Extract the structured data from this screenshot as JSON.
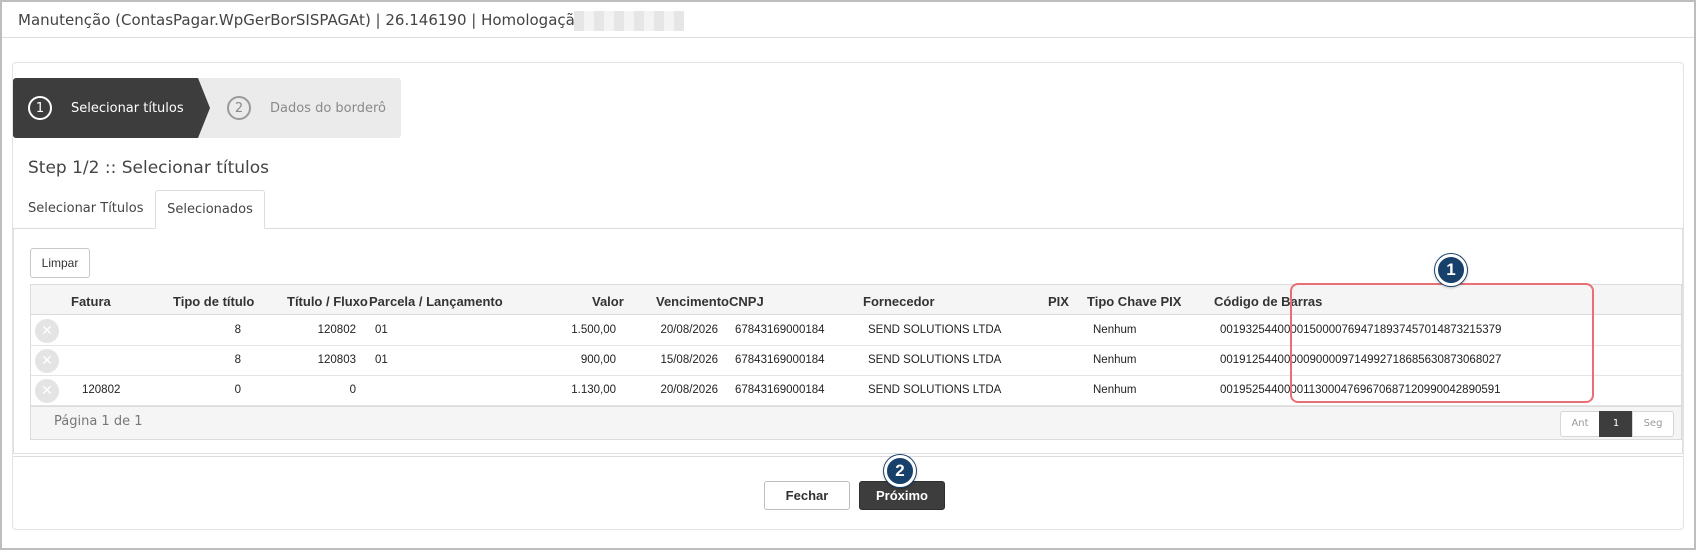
{
  "window": {
    "title": "Manutenção (ContasPagar.WpGerBorSISPAGAt) | 26.146190 | Homologação |"
  },
  "wizard": {
    "steps": [
      {
        "number": "1",
        "label": "Selecionar títulos",
        "active": true
      },
      {
        "number": "2",
        "label": "Dados do borderô",
        "active": false
      }
    ],
    "heading": "Step 1/2 :: Selecionar títulos"
  },
  "tabs": [
    {
      "label": "Selecionar Títulos",
      "selected": false
    },
    {
      "label": "Selecionados",
      "selected": true
    }
  ],
  "toolbar": {
    "limpar_label": "Limpar"
  },
  "grid": {
    "columns": [
      "Fatura",
      "Tipo de título",
      "Título / Fluxo",
      "Parcela / Lançamento",
      "Valor",
      "Vencimento",
      "CNPJ",
      "Fornecedor",
      "PIX",
      "Tipo Chave PIX",
      "Código de Barras"
    ],
    "rows": [
      {
        "fatura": "",
        "tipo": "8",
        "titulo": "120802",
        "parcela": "01",
        "valor": "1.500,00",
        "vencimento": "20/08/2026",
        "cnpj": "67843169000184",
        "fornecedor": "SEND SOLUTIONS LTDA",
        "pix": "",
        "tipo_chave": "Nenhum",
        "codigo": "00193254400001500007694718937457014873215379"
      },
      {
        "fatura": "",
        "tipo": "8",
        "titulo": "120803",
        "parcela": "01",
        "valor": "900,00",
        "vencimento": "15/08/2026",
        "cnpj": "67843169000184",
        "fornecedor": "SEND SOLUTIONS LTDA",
        "pix": "",
        "tipo_chave": "Nenhum",
        "codigo": "00191254400000900009714992718685630873068027"
      },
      {
        "fatura": "120802",
        "tipo": "0",
        "titulo": "0",
        "parcela": "",
        "valor": "1.130,00",
        "vencimento": "20/08/2026",
        "cnpj": "67843169000184",
        "fornecedor": "SEND SOLUTIONS LTDA",
        "pix": "",
        "tipo_chave": "Nenhum",
        "codigo": "00195254400001130004769670687120990042890591"
      }
    ]
  },
  "pager": {
    "text": "Página 1 de 1",
    "prev": "Ant",
    "current": "1",
    "next": "Seg"
  },
  "footer": {
    "fechar_label": "Fechar",
    "proximo_label": "Próximo"
  },
  "annotations": {
    "marker1": "1",
    "marker2": "2",
    "highlight_color": "#e86f75",
    "marker_color": "#17406a"
  }
}
